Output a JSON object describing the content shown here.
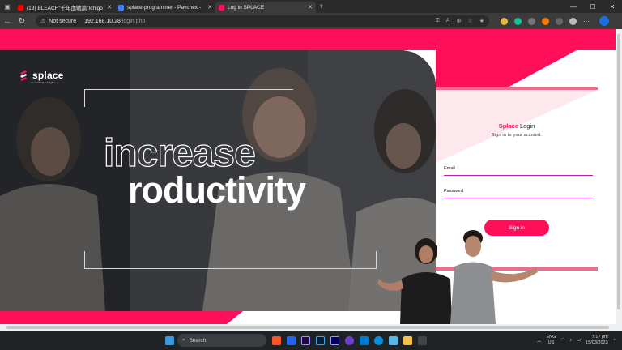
{
  "browser": {
    "tabs": [
      {
        "title": "(19) BLEACH\"千年血戦篇\"Ichigo",
        "favicon_color": "#ff0000",
        "active": false
      },
      {
        "title": "splace-programmer - Paychex -",
        "favicon_color": "#4285f4",
        "active": false
      },
      {
        "title": "Log in SPLACE",
        "favicon_color": "#ff0f5a",
        "active": true
      }
    ],
    "address": {
      "security_label": "Not secure",
      "host": "192.168.10.28",
      "path": "/login.php"
    }
  },
  "hero": {
    "logo_text": "splace",
    "logo_tagline": "connections & insights",
    "headline_outline": "increase",
    "headline_solid": "roductivity"
  },
  "login": {
    "brand": "Splace",
    "title_rest": " Login",
    "subtitle": "Sign in to your account.",
    "email_label": "Email",
    "password_label": "Password",
    "signin_label": "Sign in"
  },
  "taskbar": {
    "search_label": "Search",
    "lang_top": "ENG",
    "lang_bottom": "US",
    "time": "7:17 pm",
    "date": "15/03/2023"
  },
  "colors": {
    "accent": "#ff0f5a",
    "card_border": "#f06a8e",
    "field_line": "#c41fb0"
  }
}
